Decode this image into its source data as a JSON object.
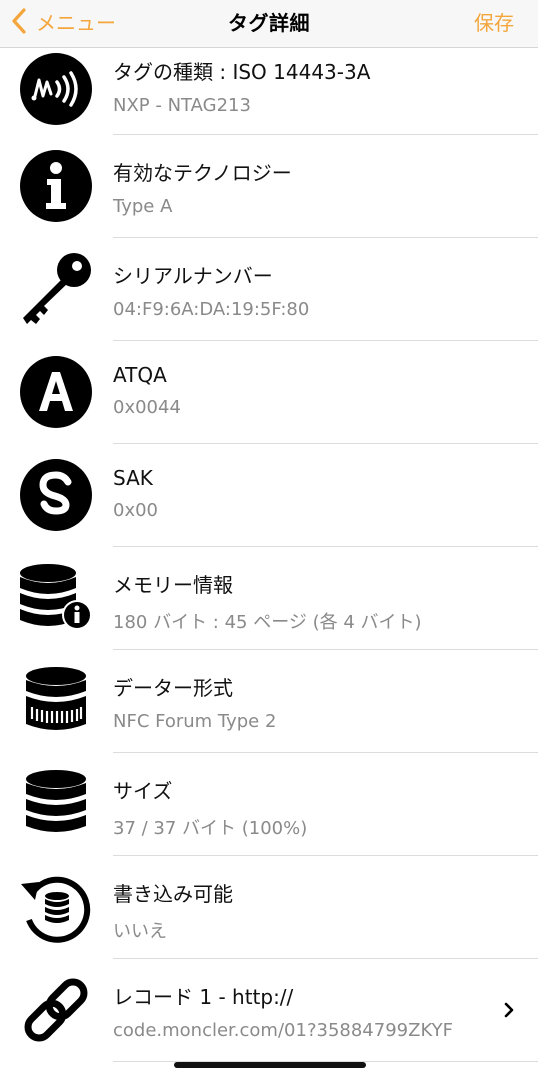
{
  "nav": {
    "back_label": "メニュー",
    "title": "タグ詳細",
    "save_label": "保存",
    "accent": "#f4a63c"
  },
  "items": [
    {
      "label": "タグの種類 : ISO 14443-3A",
      "value": "NXP - NTAG213",
      "icon": "nfc-wave-icon"
    },
    {
      "label": "有効なテクノロジー",
      "value": "Type A",
      "icon": "info-icon"
    },
    {
      "label": "シリアルナンバー",
      "value": "04:F9:6A:DA:19:5F:80",
      "icon": "key-icon"
    },
    {
      "label": "ATQA",
      "value": "0x0044",
      "icon": "letter-a-icon"
    },
    {
      "label": "SAK",
      "value": "0x00",
      "icon": "letter-s-icon"
    },
    {
      "label": "メモリー情報",
      "value": "180 バイト : 45 ページ (各 4 バイト)",
      "icon": "database-info-icon"
    },
    {
      "label": "データー形式",
      "value": "NFC Forum Type 2",
      "icon": "database-format-icon"
    },
    {
      "label": "サイズ",
      "value": "37 / 37 バイト (100%)",
      "icon": "database-icon"
    },
    {
      "label": "書き込み可能",
      "value": "いいえ",
      "icon": "database-refresh-icon"
    },
    {
      "label": "レコード 1 - http://",
      "value": "code.moncler.com/01?35884799ZKYF",
      "icon": "link-icon"
    }
  ]
}
